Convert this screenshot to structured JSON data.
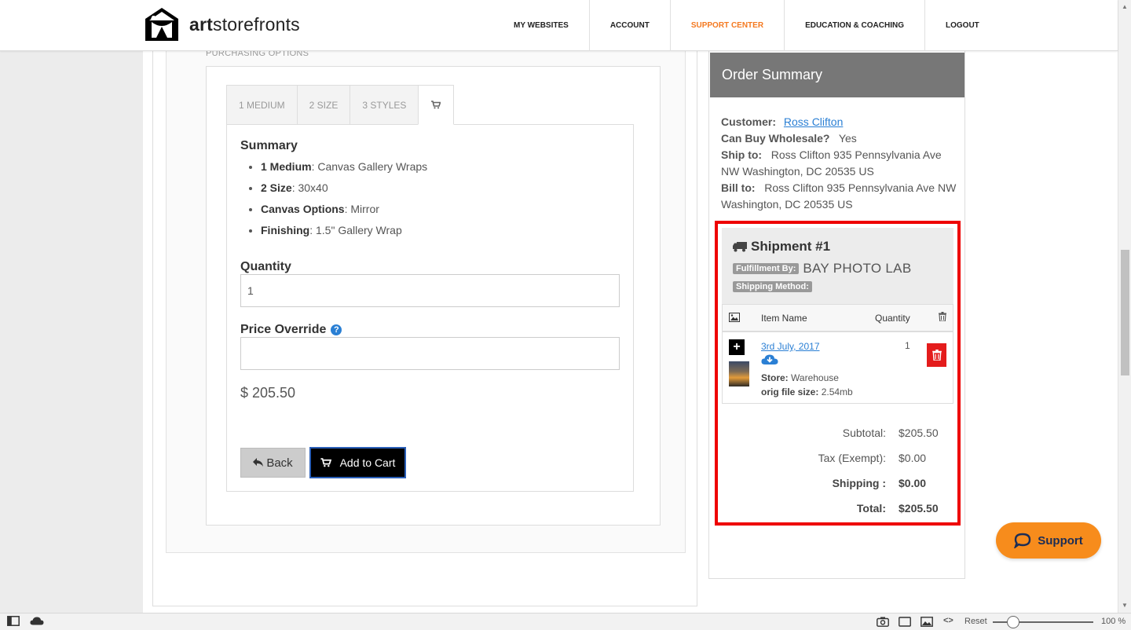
{
  "header": {
    "logo_text_bold": "art",
    "logo_text_rest": "storefronts",
    "nav": [
      {
        "label": "MY WEBSITES"
      },
      {
        "label": "ACCOUNT"
      },
      {
        "label": "SUPPORT CENTER",
        "active": true
      },
      {
        "label": "EDUCATION & COACHING"
      },
      {
        "label": "LOGOUT"
      }
    ]
  },
  "purchasing": {
    "section_label": "PURCHASING OPTIONS",
    "tabs": [
      {
        "label": "1 MEDIUM"
      },
      {
        "label": "2 SIZE"
      },
      {
        "label": "3 STYLES"
      },
      {
        "icon": "cart-icon"
      }
    ],
    "summary_title": "Summary",
    "summary_items": [
      {
        "key": "1 Medium",
        "value": ": Canvas Gallery Wraps"
      },
      {
        "key": "2 Size",
        "value": ": 30x40"
      },
      {
        "key": "Canvas Options",
        "value": ": Mirror"
      },
      {
        "key": "Finishing",
        "value": ": 1.5\" Gallery Wrap"
      }
    ],
    "quantity_label": "Quantity",
    "quantity_value": "1",
    "price_override_label": "Price Override",
    "price_override_value": "",
    "price": "$ 205.50",
    "back_label": "Back",
    "add_to_cart_label": "Add to Cart"
  },
  "order": {
    "title": "Order Summary",
    "customer_label": "Customer:",
    "customer_name": "Ross Clifton",
    "wholesale_label": "Can Buy Wholesale?",
    "wholesale_value": "Yes",
    "ship_to_label": "Ship to:",
    "ship_to_value": "Ross Clifton 935 Pennsylvania Ave NW Washington, DC 20535 US",
    "bill_to_label": "Bill to:",
    "bill_to_value": "Ross Clifton 935 Pennsylvania Ave NW Washington, DC 20535 US",
    "shipment": {
      "title": "Shipment #1",
      "fulfillment_label": "Fulfillment By:",
      "fulfillment_value": "BAY PHOTO LAB",
      "shipping_method_label": "Shipping Method:",
      "columns": {
        "item": "Item Name",
        "quantity": "Quantity"
      },
      "item": {
        "name": "3rd July, 2017",
        "store_label": "Store:",
        "store_value": "Warehouse",
        "size_label": "orig file size:",
        "size_value": "2.54mb",
        "quantity": "1"
      }
    },
    "totals": [
      {
        "label": "Subtotal:",
        "value": "$205.50"
      },
      {
        "label": "Tax (Exempt):",
        "value": "$0.00"
      },
      {
        "label": "Shipping :",
        "value": "$0.00",
        "bold": true
      },
      {
        "label": "Total:",
        "value": "$205.50",
        "bold": true
      }
    ]
  },
  "support_button": "Support",
  "statusbar": {
    "reset": "Reset",
    "zoom": "100 %"
  },
  "colors": {
    "accent": "#f47920",
    "link": "#2a7fd4",
    "highlight": "#e00000",
    "delete": "#e41c1c"
  }
}
